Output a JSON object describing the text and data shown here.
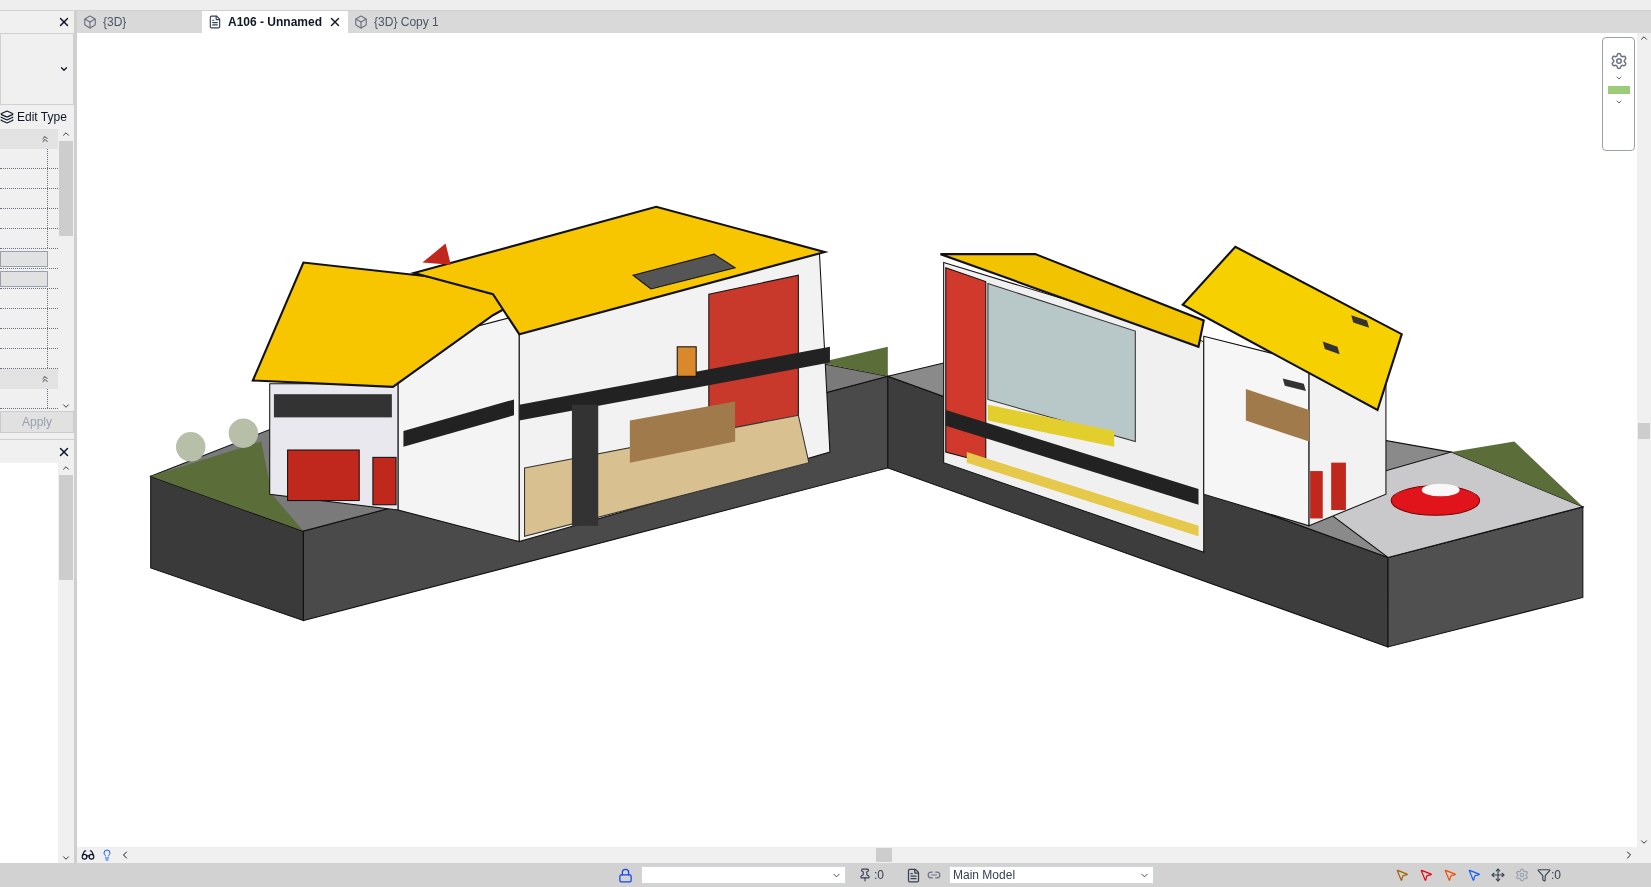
{
  "tabs": [
    {
      "label": "{3D}",
      "kind": "model",
      "selected": false
    },
    {
      "label": "A106 - Unnamed",
      "kind": "sheet",
      "selected": true
    },
    {
      "label": "{3D} Copy 1",
      "kind": "model",
      "selected": false
    }
  ],
  "properties_panel": {
    "edit_type": "Edit Type",
    "rows": [
      {
        "kind": "group"
      },
      {
        "kind": "field"
      },
      {
        "kind": "field"
      },
      {
        "kind": "field"
      },
      {
        "kind": "field"
      },
      {
        "kind": "field"
      },
      {
        "kind": "button"
      },
      {
        "kind": "button"
      },
      {
        "kind": "field"
      },
      {
        "kind": "field"
      },
      {
        "kind": "field"
      },
      {
        "kind": "field"
      },
      {
        "kind": "group"
      },
      {
        "kind": "field"
      }
    ],
    "apply": {
      "label": "Apply",
      "disabled": true
    }
  },
  "status_bar": {
    "selection_count": ":0",
    "workset": "Main Model",
    "filter_count": ":0"
  }
}
